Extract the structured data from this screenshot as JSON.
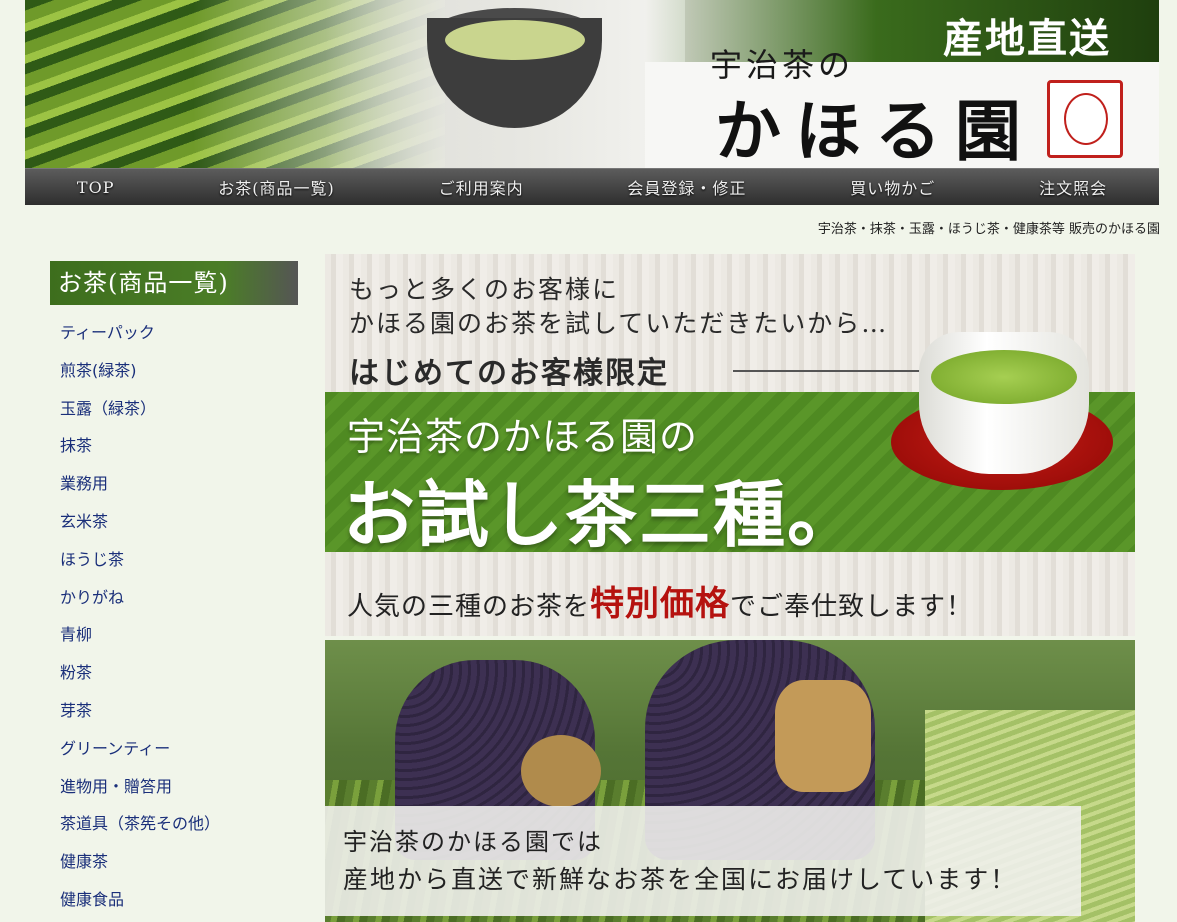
{
  "header": {
    "tagline": "産地直送",
    "logo_small": "宇治茶の",
    "logo_main": "かほる園",
    "field_image": "tea-field-photo",
    "cup_image": "teacup-photo",
    "stamp": "portrait-stamp"
  },
  "nav": {
    "items": [
      {
        "label": "TOP"
      },
      {
        "label": "お茶(商品一覧)"
      },
      {
        "label": "ご利用案内"
      },
      {
        "label": "会員登録・修正"
      },
      {
        "label": "買い物かご"
      },
      {
        "label": "注文照会"
      }
    ]
  },
  "breadcrumb": "宇治茶・抹茶・玉露・ほうじ茶・健康茶等 販売のかほる園",
  "sidebar": {
    "heading": "お茶(商品一覧)",
    "items": [
      {
        "label": "ティーパック"
      },
      {
        "label": "煎茶(緑茶)"
      },
      {
        "label": "玉露（緑茶）"
      },
      {
        "label": "抹茶"
      },
      {
        "label": "業務用"
      },
      {
        "label": "玄米茶"
      },
      {
        "label": "ほうじ茶"
      },
      {
        "label": "かりがね"
      },
      {
        "label": "青柳"
      },
      {
        "label": "粉茶"
      },
      {
        "label": "芽茶"
      },
      {
        "label": "グリーンティー"
      },
      {
        "label": "進物用・贈答用"
      },
      {
        "label": "茶道具（茶筅その他）"
      },
      {
        "label": "健康茶"
      },
      {
        "label": "健康食品"
      }
    ]
  },
  "banner_trial": {
    "line1": "もっと多くのお客様に",
    "line2": "かほる園のお茶を試していただきたいから…",
    "line3": "はじめてのお客様限定",
    "green_line1": "宇治茶のかほる園の",
    "green_line2": "お試し茶三種。",
    "bottom_pre": "人気の三種のお茶を",
    "bottom_red": "特別価格",
    "bottom_post": "でご奉仕致します！"
  },
  "banner_farm": {
    "caption_line1": "宇治茶のかほる園では",
    "caption_line2": "産地から直送で新鮮なお茶を全国にお届けしています！"
  },
  "colors": {
    "page_bg": "#f1f5ea",
    "brand_green": "#4b7d27",
    "link": "#1a2f7a",
    "accent_red": "#b5120f"
  }
}
